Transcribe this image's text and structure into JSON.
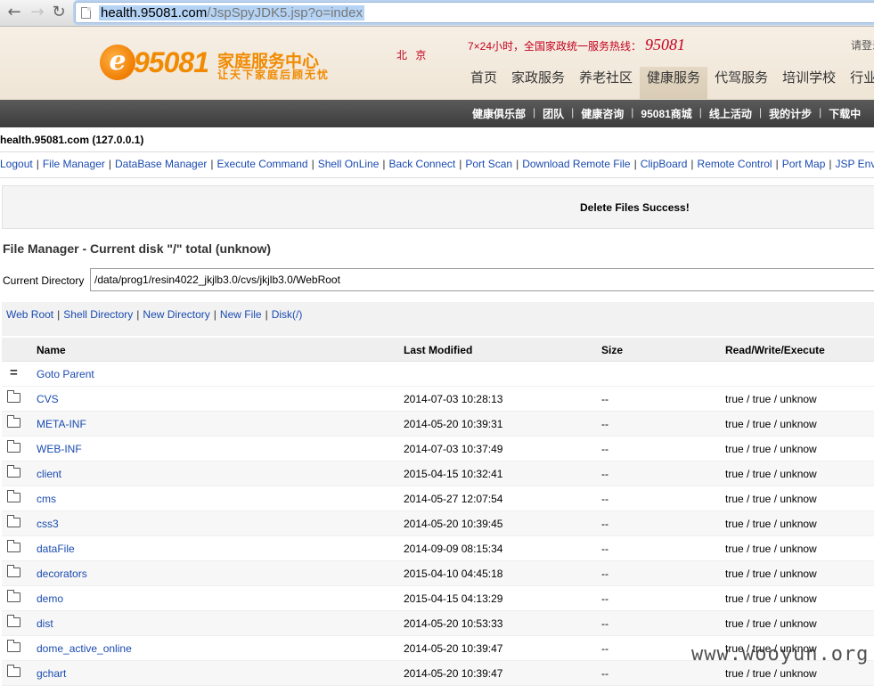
{
  "browser": {
    "url_host": "health.95081.com",
    "url_path": "/JspSpyJDK5.jsp?o=index",
    "back_icon": "arrow-left-icon",
    "forward_icon": "arrow-right-icon",
    "reload_icon": "reload-icon"
  },
  "site": {
    "logo_e": "e",
    "logo_number": "95081",
    "logo_name": "家庭服务中心",
    "logo_slogan": "让天下家庭后顾无忧",
    "city": "北 京",
    "hotline_label": "7×24小时，全国家政统一服务热线：",
    "hotline_number": "95081",
    "login_text": "请登录",
    "main_nav": [
      "首页",
      "家政服务",
      "养老社区",
      "健康服务",
      "代驾服务",
      "培训学校",
      "行业码"
    ],
    "sub_nav": [
      "健康俱乐部",
      "团队",
      "健康咨询",
      "95081商城",
      "线上活动",
      "我的计步",
      "下载中"
    ]
  },
  "shell": {
    "host_line": "health.95081.com (127.0.0.1)",
    "menu": [
      "Logout",
      "File Manager",
      "DataBase Manager",
      "Execute Command",
      "Shell OnLine",
      "Back Connect",
      "Port Scan",
      "Download Remote File",
      "ClipBoard",
      "Remote Control",
      "Port Map",
      "JSP Env"
    ],
    "message": "Delete Files Success!",
    "fm_title": "File Manager - Current disk \"/\" total (unknow)",
    "current_dir_label": "Current Directory",
    "current_dir_value": "/data/prog1/resin4022_jkjlb3.0/cvs/jkjlb3.0/WebRoot",
    "quick_links": [
      "Web Root",
      "Shell Directory",
      "New Directory",
      "New File",
      "Disk(/)"
    ],
    "table": {
      "headers": [
        "Name",
        "Last Modified",
        "Size",
        "Read/Write/Execute"
      ],
      "parent": {
        "icon": "=",
        "name": "Goto Parent"
      },
      "rows": [
        {
          "name": "CVS",
          "modified": "2014-07-03 10:28:13",
          "size": "--",
          "rwx": "true / true / unknow"
        },
        {
          "name": "META-INF",
          "modified": "2014-05-20 10:39:31",
          "size": "--",
          "rwx": "true / true / unknow"
        },
        {
          "name": "WEB-INF",
          "modified": "2014-07-03 10:37:49",
          "size": "--",
          "rwx": "true / true / unknow"
        },
        {
          "name": "client",
          "modified": "2015-04-15 10:32:41",
          "size": "--",
          "rwx": "true / true / unknow"
        },
        {
          "name": "cms",
          "modified": "2014-05-27 12:07:54",
          "size": "--",
          "rwx": "true / true / unknow"
        },
        {
          "name": "css3",
          "modified": "2014-05-20 10:39:45",
          "size": "--",
          "rwx": "true / true / unknow"
        },
        {
          "name": "dataFile",
          "modified": "2014-09-09 08:15:34",
          "size": "--",
          "rwx": "true / true / unknow"
        },
        {
          "name": "decorators",
          "modified": "2015-04-10 04:45:18",
          "size": "--",
          "rwx": "true / true / unknow"
        },
        {
          "name": "demo",
          "modified": "2015-04-15 04:13:29",
          "size": "--",
          "rwx": "true / true / unknow"
        },
        {
          "name": "dist",
          "modified": "2014-05-20 10:53:33",
          "size": "--",
          "rwx": "true / true / unknow"
        },
        {
          "name": "dome_active_online",
          "modified": "2014-05-20 10:39:47",
          "size": "--",
          "rwx": "true / true / unknow"
        },
        {
          "name": "gchart",
          "modified": "2014-05-20 10:39:47",
          "size": "--",
          "rwx": "true / true / unknow"
        }
      ]
    }
  },
  "watermark": "www.wooyun.org"
}
